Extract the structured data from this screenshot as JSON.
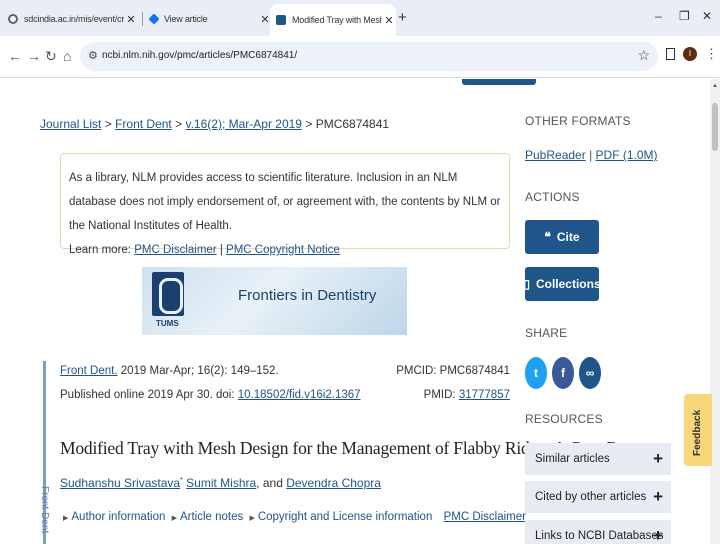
{
  "tabs": [
    {
      "title": "sdcindia.ac.in/mis/event/create",
      "favicon_color": "#5f6368"
    },
    {
      "title": "View article",
      "favicon_color": "#1a73e8"
    },
    {
      "title": "Modified Tray with Mesh Desig",
      "favicon_color": "#20558a"
    }
  ],
  "browser": {
    "url": "ncbi.nlm.nih.gov/pmc/articles/PMC6874841/",
    "avatar_letter": "I"
  },
  "breadcrumb": {
    "journal_list": "Journal List",
    "journal": "Front Dent",
    "issue": "v.16(2); Mar-Apr 2019",
    "pmc": "PMC6874841",
    "sep": ">"
  },
  "notice": {
    "text": "As a library, NLM provides access to scientific literature. Inclusion in an NLM database does not imply endorsement of, or agreement with, the contents by NLM or the National Institutes of Health.",
    "learn_more": "Learn more:",
    "disclaimer_link": "PMC Disclaimer",
    "separator": "|",
    "copyright_link": "PMC Copyright Notice"
  },
  "journal_logo": {
    "name": "Frontiers in Dentistry",
    "org": "TUMS"
  },
  "citation": {
    "journal_link": "Front Dent.",
    "details": "2019 Mar-Apr; 16(2): 149–152.",
    "published": "Published online 2019 Apr 30. doi:",
    "doi": "10.18502/fid.v16i2.1367",
    "pmcid": "PMCID: PMC6874841",
    "pmid_label": "PMID:",
    "pmid": "31777857"
  },
  "article": {
    "title": "Modified Tray with Mesh Design for the Management of Flabby Ridge: A Case Report",
    "authors": [
      {
        "name": "Sudhanshu Srivastava",
        "sup": "*"
      },
      {
        "name": "Sumit Mishra",
        "sup": ""
      },
      {
        "name": "Devendra Chopra",
        "sup": ""
      }
    ],
    "and_text": ", and",
    "vertical_label": "Front Dent",
    "info_links": {
      "author_info": "Author information",
      "article_notes": "Article notes",
      "copyright": "Copyright and License information",
      "disclaimer": "PMC Disclaimer"
    }
  },
  "sidebar": {
    "other_formats": "OTHER FORMATS",
    "pubreader": "PubReader",
    "pdf": "PDF (1.0M)",
    "actions": "ACTIONS",
    "cite": "Cite",
    "collections": "Collections",
    "share": "SHARE",
    "resources": "RESOURCES",
    "resource_items": [
      "Similar articles",
      "Cited by other articles",
      "Links to NCBI Databases"
    ]
  },
  "feedback": "Feedback",
  "colors": {
    "accent": "#20558a",
    "twitter": "#1da1f2",
    "facebook": "#3b5998",
    "link": "#20558a"
  }
}
